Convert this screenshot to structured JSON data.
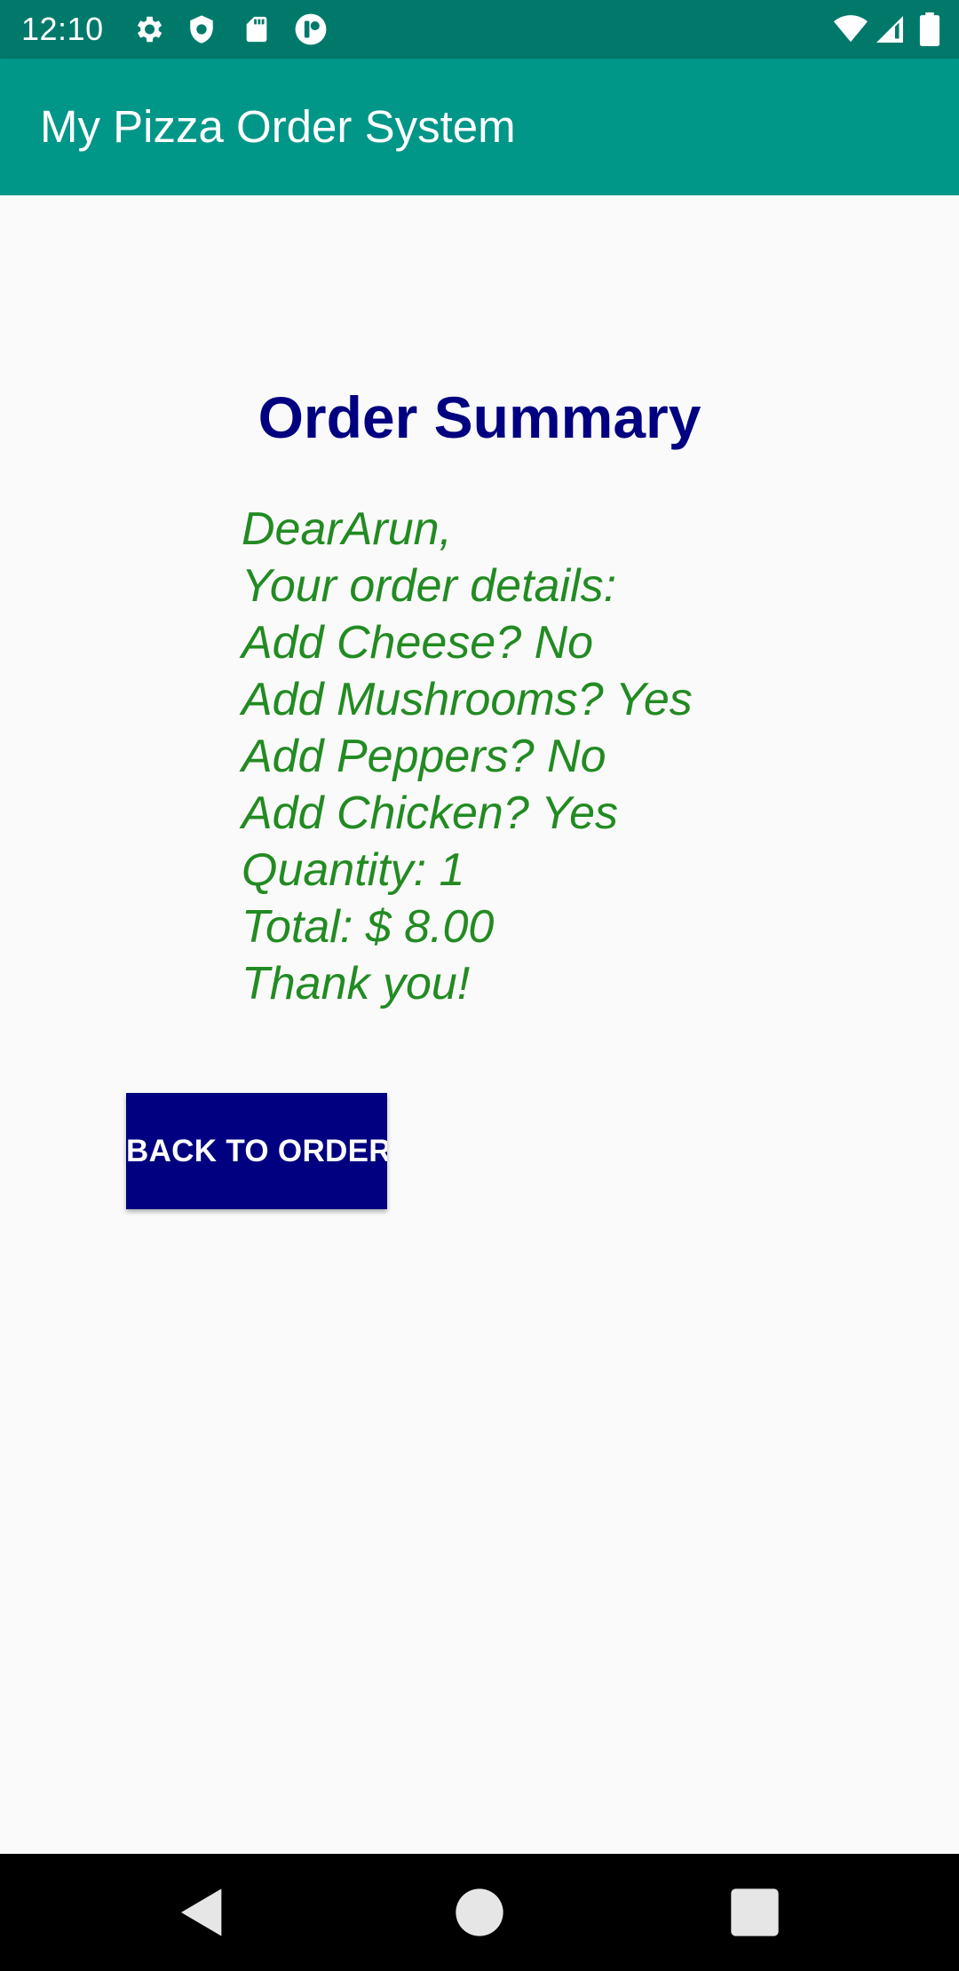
{
  "status_bar": {
    "time": "12:10",
    "left_icons": [
      "gear-icon",
      "shield-icon",
      "sd-card-icon",
      "app-badge-icon"
    ],
    "right_icons": [
      "wifi-icon",
      "signal-icon",
      "battery-icon"
    ]
  },
  "app_bar": {
    "title": "My Pizza Order System",
    "color": "#009688"
  },
  "summary": {
    "title": "Order Summary",
    "title_color": "#000080",
    "text_color": "#228b22",
    "lines": [
      "DearArun,",
      "Your order details:",
      "Add Cheese? No",
      "Add Mushrooms? Yes",
      "Add Peppers? No",
      "Add Chicken? Yes",
      "Quantity: 1",
      "Total: $ 8.00",
      "Thank you!"
    ]
  },
  "back_button": {
    "label": "BACK TO ORDER",
    "color": "#000080"
  },
  "nav_bar": {
    "buttons": [
      "back-triangle-icon",
      "home-circle-icon",
      "recents-square-icon"
    ]
  }
}
